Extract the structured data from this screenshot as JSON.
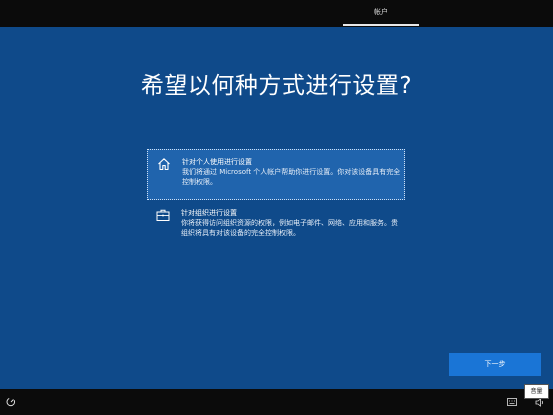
{
  "header": {
    "tab_label": "帐户"
  },
  "page": {
    "title": "希望以何种方式进行设置?"
  },
  "options": [
    {
      "title": "针对个人使用进行设置",
      "description": "我们将通过 Microsoft 个人帐户帮助你进行设置。你对该设备具有完全控制权限。",
      "icon": "home-icon",
      "selected": true
    },
    {
      "title": "针对组织进行设置",
      "description": "你将获得访问组织资源的权限，例如电子邮件、网络、应用和服务。贵组织将具有对该设备的完全控制权限。",
      "icon": "briefcase-icon",
      "selected": false
    }
  ],
  "actions": {
    "next_label": "下一步"
  },
  "taskbar": {
    "accessibility_icon": "accessibility-icon",
    "keyboard_icon": "keyboard-icon",
    "volume_icon": "volume-icon",
    "tooltip": "音量"
  },
  "colors": {
    "background": "#0f4a8a",
    "selected_option": "#2064ad",
    "button": "#1a75d6",
    "bar": "#0b0b0b"
  }
}
